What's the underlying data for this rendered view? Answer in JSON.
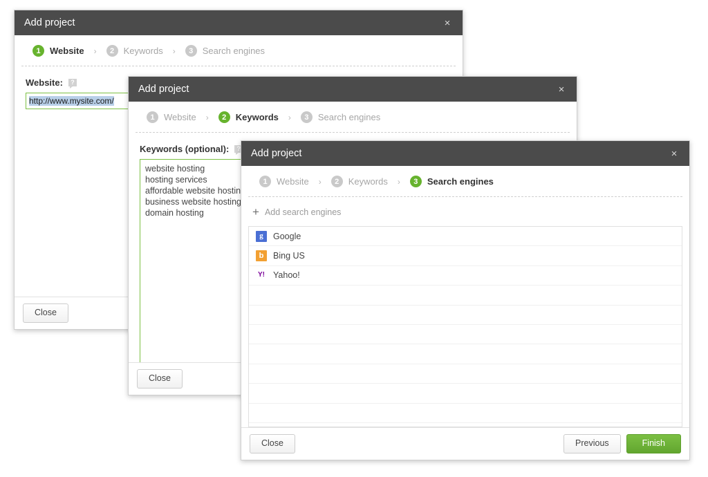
{
  "steps_labels": {
    "step1": "Website",
    "step2": "Keywords",
    "step3": "Search engines",
    "n1": "1",
    "n2": "2",
    "n3": "3",
    "separator": "›"
  },
  "close_glyph": "×",
  "dialog1": {
    "title": "Add project",
    "website_label": "Website:",
    "help_glyph": "?",
    "website_value": "http://www.mysite.com/",
    "close_button": "Close"
  },
  "dialog2": {
    "title": "Add project",
    "keywords_label": "Keywords (optional):",
    "help_glyph": "?",
    "keywords_value": "website hosting\nhosting services\naffordable website hosting\nbusiness website hosting\ndomain hosting",
    "close_button": "Close"
  },
  "dialog3": {
    "title": "Add project",
    "add_search_engines": "Add search engines",
    "plus_glyph": "+",
    "engines": [
      {
        "name": "Google",
        "icon": "google-icon",
        "mark": "g"
      },
      {
        "name": "Bing US",
        "icon": "bing-icon",
        "mark": "b"
      },
      {
        "name": "Yahoo!",
        "icon": "yahoo-icon",
        "mark": "Y!"
      }
    ],
    "empty_rows": 9,
    "close_button": "Close",
    "previous_button": "Previous",
    "finish_button": "Finish"
  },
  "colors": {
    "titlebar": "#4b4b4b",
    "accent_green": "#67b32e",
    "finish_green": "#72b839",
    "step_inactive": "#c9c9c9",
    "input_border_green": "#7cc043",
    "selection_blue": "#b8cfe8"
  }
}
